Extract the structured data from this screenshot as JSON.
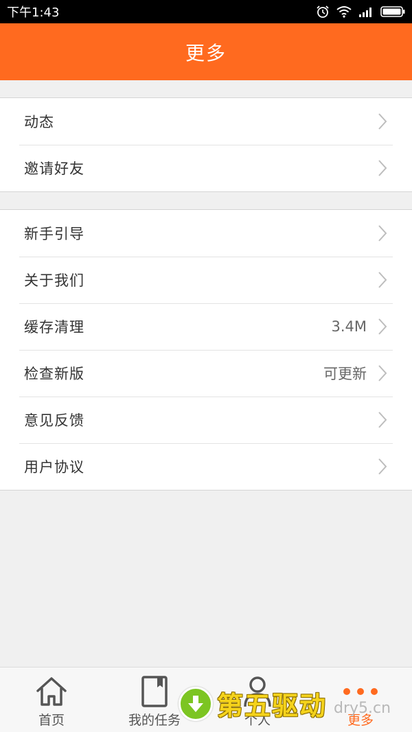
{
  "status_bar": {
    "time": "下午1:43",
    "icons": [
      "alarm-icon",
      "wifi-icon",
      "signal-icon",
      "battery-icon"
    ]
  },
  "header": {
    "title": "更多"
  },
  "groups": [
    {
      "items": [
        {
          "label": "动态",
          "value": ""
        },
        {
          "label": "邀请好友",
          "value": ""
        }
      ]
    },
    {
      "items": [
        {
          "label": "新手引导",
          "value": ""
        },
        {
          "label": "关于我们",
          "value": ""
        },
        {
          "label": "缓存清理",
          "value": "3.4M"
        },
        {
          "label": "检查新版",
          "value": "可更新"
        },
        {
          "label": "意见反馈",
          "value": ""
        },
        {
          "label": "用户协议",
          "value": ""
        }
      ]
    }
  ],
  "tab_bar": {
    "active_index": 3,
    "tabs": [
      {
        "label": "首页",
        "icon": "home-icon"
      },
      {
        "label": "我的任务",
        "icon": "book-icon"
      },
      {
        "label": "个人",
        "icon": "user-icon"
      },
      {
        "label": "更多",
        "icon": "more-dots-icon"
      }
    ]
  },
  "watermark": {
    "text": "第五驱动",
    "url": "dry5.cn",
    "icon": "download-arrow-icon"
  },
  "colors": {
    "accent": "#ff6a1f",
    "background": "#f0f0f0",
    "watermark_green": "#7cc522",
    "watermark_yellow": "#f5d31c"
  }
}
